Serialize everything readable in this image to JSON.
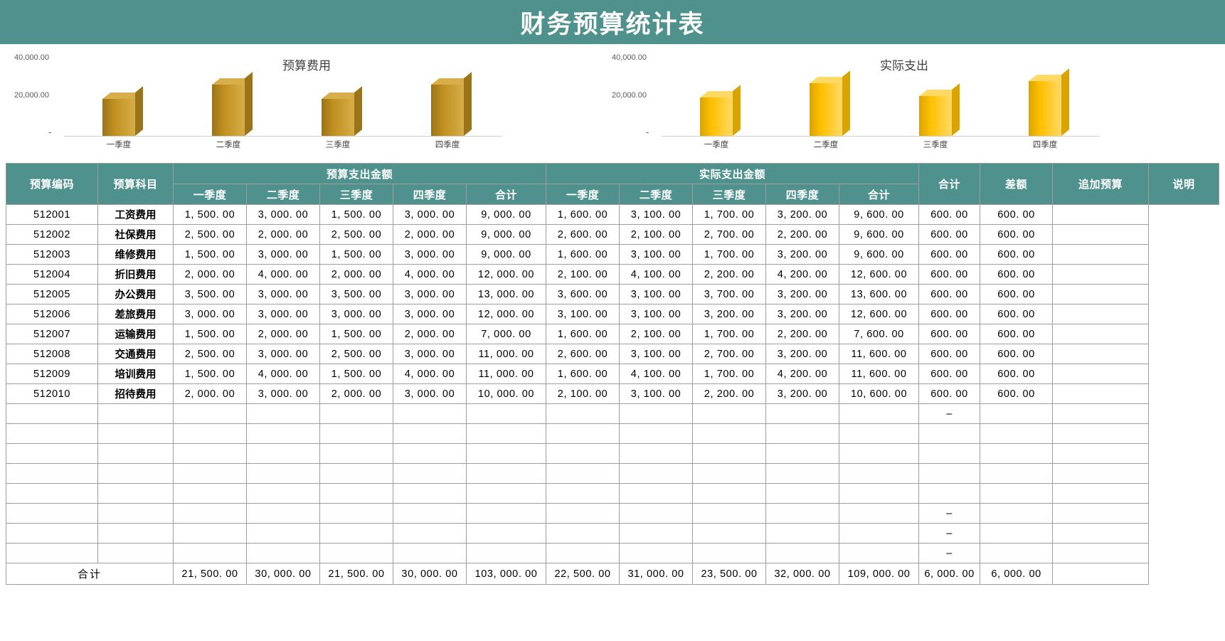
{
  "header": {
    "title": "财务预算统计表",
    "bar_color": "#4E918D"
  },
  "charts": [
    {
      "name": "budget-chart",
      "title": "预算费用",
      "y_labels": {
        "top": "40,000.00",
        "mid": "20,000.00",
        "zero": "-"
      },
      "categories": [
        "一季度",
        "二季度",
        "三季度",
        "四季度"
      ],
      "bar_color": "#BF8F1F",
      "bar_top_color": "#D8AE4A",
      "bar_side_color": "#9A7419"
    },
    {
      "name": "actual-chart",
      "title": "实际支出",
      "y_labels": {
        "top": "40,000.00",
        "mid": "20,000.00",
        "zero": "-"
      },
      "categories": [
        "一季度",
        "二季度",
        "三季度",
        "四季度"
      ],
      "bar_color": "#FFC000",
      "bar_top_color": "#FFD966",
      "bar_side_color": "#D9A400"
    }
  ],
  "chart_data": [
    {
      "type": "bar",
      "title": "预算费用",
      "categories": [
        "一季度",
        "二季度",
        "三季度",
        "四季度"
      ],
      "values": [
        21500,
        30000,
        21500,
        30000
      ],
      "xlabel": "",
      "ylabel": "",
      "ylim": [
        0,
        40000
      ],
      "ticks": [
        "-",
        "20,000.00",
        "40,000.00"
      ],
      "grid": false,
      "legend": "none"
    },
    {
      "type": "bar",
      "title": "实际支出",
      "categories": [
        "一季度",
        "二季度",
        "三季度",
        "四季度"
      ],
      "values": [
        22500,
        31000,
        23500,
        32000
      ],
      "xlabel": "",
      "ylabel": "",
      "ylim": [
        0,
        40000
      ],
      "ticks": [
        "-",
        "20,000.00",
        "40,000.00"
      ],
      "grid": false,
      "legend": "none"
    }
  ],
  "table": {
    "headers": {
      "code": "预算编码",
      "subject": "预算科目",
      "budget_group": "预算支出金额",
      "actual_group": "实际支出金额",
      "quarters": [
        "一季度",
        "二季度",
        "三季度",
        "四季度"
      ],
      "budget_total": "合计",
      "actual_total": "合计",
      "grand_total": "合计",
      "variance": "差额",
      "extra_budget": "追加预算",
      "remark": "说明"
    },
    "rows": [
      {
        "code": "512001",
        "subject": "工资费用",
        "budget": [
          "1, 500. 00",
          "3, 000. 00",
          "1, 500. 00",
          "3, 000. 00"
        ],
        "budget_sum": "9, 000. 00",
        "actual": [
          "1, 600. 00",
          "3, 100. 00",
          "1, 700. 00",
          "3, 200. 00"
        ],
        "actual_sum": "9, 600. 00",
        "variance": "600. 00",
        "extra": "600. 00",
        "remark": ""
      },
      {
        "code": "512002",
        "subject": "社保费用",
        "budget": [
          "2, 500. 00",
          "2, 000. 00",
          "2, 500. 00",
          "2, 000. 00"
        ],
        "budget_sum": "9, 000. 00",
        "actual": [
          "2, 600. 00",
          "2, 100. 00",
          "2, 700. 00",
          "2, 200. 00"
        ],
        "actual_sum": "9, 600. 00",
        "variance": "600. 00",
        "extra": "600. 00",
        "remark": ""
      },
      {
        "code": "512003",
        "subject": "维修费用",
        "budget": [
          "1, 500. 00",
          "3, 000. 00",
          "1, 500. 00",
          "3, 000. 00"
        ],
        "budget_sum": "9, 000. 00",
        "actual": [
          "1, 600. 00",
          "3, 100. 00",
          "1, 700. 00",
          "3, 200. 00"
        ],
        "actual_sum": "9, 600. 00",
        "variance": "600. 00",
        "extra": "600. 00",
        "remark": ""
      },
      {
        "code": "512004",
        "subject": "折旧费用",
        "budget": [
          "2, 000. 00",
          "4, 000. 00",
          "2, 000. 00",
          "4, 000. 00"
        ],
        "budget_sum": "12, 000. 00",
        "actual": [
          "2, 100. 00",
          "4, 100. 00",
          "2, 200. 00",
          "4, 200. 00"
        ],
        "actual_sum": "12, 600. 00",
        "variance": "600. 00",
        "extra": "600. 00",
        "remark": ""
      },
      {
        "code": "512005",
        "subject": "办公费用",
        "budget": [
          "3, 500. 00",
          "3, 000. 00",
          "3, 500. 00",
          "3, 000. 00"
        ],
        "budget_sum": "13, 000. 00",
        "actual": [
          "3, 600. 00",
          "3, 100. 00",
          "3, 700. 00",
          "3, 200. 00"
        ],
        "actual_sum": "13, 600. 00",
        "variance": "600. 00",
        "extra": "600. 00",
        "remark": ""
      },
      {
        "code": "512006",
        "subject": "差旅费用",
        "budget": [
          "3, 000. 00",
          "3, 000. 00",
          "3, 000. 00",
          "3, 000. 00"
        ],
        "budget_sum": "12, 000. 00",
        "actual": [
          "3, 100. 00",
          "3, 100. 00",
          "3, 200. 00",
          "3, 200. 00"
        ],
        "actual_sum": "12, 600. 00",
        "variance": "600. 00",
        "extra": "600. 00",
        "remark": ""
      },
      {
        "code": "512007",
        "subject": "运输费用",
        "budget": [
          "1, 500. 00",
          "2, 000. 00",
          "1, 500. 00",
          "2, 000. 00"
        ],
        "budget_sum": "7, 000. 00",
        "actual": [
          "1, 600. 00",
          "2, 100. 00",
          "1, 700. 00",
          "2, 200. 00"
        ],
        "actual_sum": "7, 600. 00",
        "variance": "600. 00",
        "extra": "600. 00",
        "remark": ""
      },
      {
        "code": "512008",
        "subject": "交通费用",
        "budget": [
          "2, 500. 00",
          "3, 000. 00",
          "2, 500. 00",
          "3, 000. 00"
        ],
        "budget_sum": "11, 000. 00",
        "actual": [
          "2, 600. 00",
          "3, 100. 00",
          "2, 700. 00",
          "3, 200. 00"
        ],
        "actual_sum": "11, 600. 00",
        "variance": "600. 00",
        "extra": "600. 00",
        "remark": ""
      },
      {
        "code": "512009",
        "subject": "培训费用",
        "budget": [
          "1, 500. 00",
          "4, 000. 00",
          "1, 500. 00",
          "4, 000. 00"
        ],
        "budget_sum": "11, 000. 00",
        "actual": [
          "1, 600. 00",
          "4, 100. 00",
          "1, 700. 00",
          "4, 200. 00"
        ],
        "actual_sum": "11, 600. 00",
        "variance": "600. 00",
        "extra": "600. 00",
        "remark": ""
      },
      {
        "code": "512010",
        "subject": "招待费用",
        "budget": [
          "2, 000. 00",
          "3, 000. 00",
          "2, 000. 00",
          "3, 000. 00"
        ],
        "budget_sum": "10, 000. 00",
        "actual": [
          "2, 100. 00",
          "3, 100. 00",
          "2, 200. 00",
          "3, 200. 00"
        ],
        "actual_sum": "10, 600. 00",
        "variance": "600. 00",
        "extra": "600. 00",
        "remark": ""
      }
    ],
    "empty_rows": [
      {
        "variance": "–"
      },
      {
        "variance": ""
      },
      {
        "variance": ""
      },
      {
        "variance": ""
      },
      {
        "variance": ""
      },
      {
        "variance": "–"
      },
      {
        "variance": "–"
      },
      {
        "variance": "–"
      }
    ],
    "total_row": {
      "label": "合计",
      "budget": [
        "21, 500. 00",
        "30, 000. 00",
        "21, 500. 00",
        "30, 000. 00"
      ],
      "budget_sum": "103, 000. 00",
      "actual": [
        "22, 500. 00",
        "31, 000. 00",
        "23, 500. 00",
        "32, 000. 00"
      ],
      "actual_sum": "109, 000. 00",
      "variance": "6, 000. 00",
      "extra": "6, 000. 00",
      "remark": ""
    }
  }
}
